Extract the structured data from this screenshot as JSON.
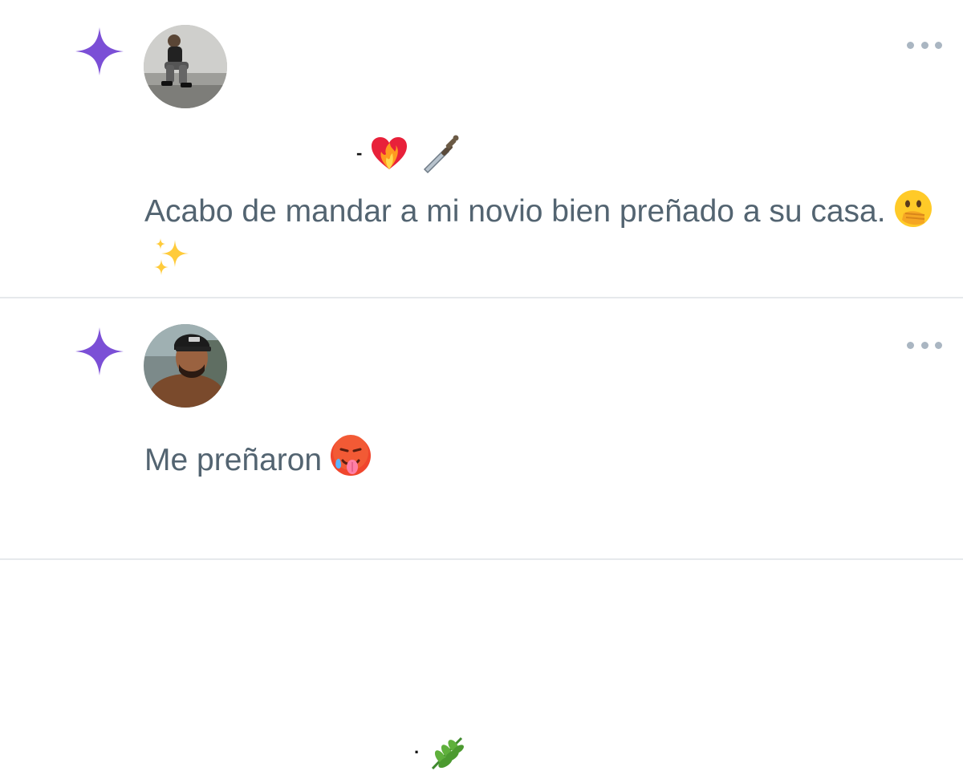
{
  "posts": [
    {
      "author_icon": "sparkle-icon",
      "avatar": "user-avatar-photo",
      "name_suffix": "-",
      "name_emojis": [
        "heart-on-fire-emoji",
        "dagger-emoji"
      ],
      "text": "Acabo de mandar a mi novio bien preñado a su casa.",
      "text_emojis": [
        "face-with-hand-over-mouth-emoji",
        "sparkles-emoji"
      ],
      "more_icon": "more-options-icon"
    },
    {
      "author_icon": "sparkle-icon",
      "avatar": "user-avatar-photo",
      "name_suffix": "·",
      "name_emojis": [
        "herb-emoji"
      ],
      "text": "Me preñaron",
      "text_emojis": [
        "hot-face-emoji"
      ],
      "more_icon": "more-options-icon"
    }
  ],
  "colors": {
    "sparkle": "#7b4fd6",
    "text": "#536471",
    "divider": "#e6e9ec",
    "more_dots": "#aab6c2"
  }
}
